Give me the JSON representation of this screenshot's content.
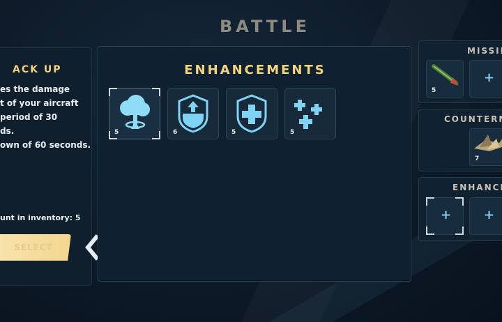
{
  "screen": {
    "title": "BATTLE"
  },
  "detail": {
    "title": "ACK UP",
    "description_lines": [
      "es the damage",
      "t of your aircraft",
      "period of 30",
      "ds.",
      "own of 60 seconds."
    ],
    "inventory_text": "unt in inventory: 5",
    "select_label": "SELECT"
  },
  "enhancements": {
    "title": "ENHANCEMENTS",
    "items": [
      {
        "icon": "shield-cloud-icon",
        "count": "5",
        "selected": true
      },
      {
        "icon": "armor-up-icon",
        "count": "6",
        "selected": false
      },
      {
        "icon": "shield-plus-icon",
        "count": "5",
        "selected": false
      },
      {
        "icon": "repair-plus-icon",
        "count": "5",
        "selected": false
      }
    ]
  },
  "loadout": {
    "missiles": {
      "title": "MISSILE",
      "slots": [
        {
          "icon": "missile-icon",
          "count": "5"
        },
        {
          "icon": "add-icon",
          "count": ""
        }
      ]
    },
    "countermeasures": {
      "title": "COUNTERMEA",
      "slots": [
        {
          "icon": "chaff-icon",
          "count": "7"
        }
      ]
    },
    "enhancements": {
      "title": "ENHANCEM",
      "slots": [
        {
          "icon": "add-icon"
        },
        {
          "icon": "add-icon"
        }
      ]
    }
  },
  "colors": {
    "accent": "#f2d57c",
    "icon": "#7fd3f5",
    "panel": "#0f2030"
  }
}
